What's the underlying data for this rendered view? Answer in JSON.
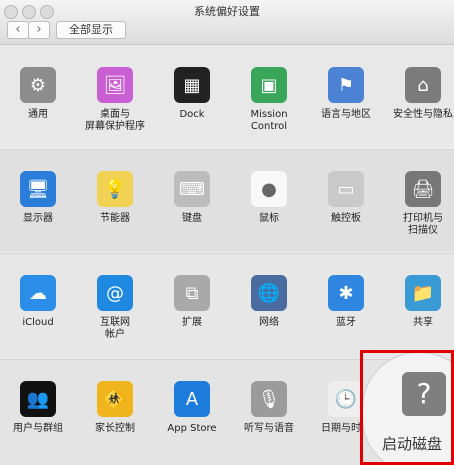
{
  "window": {
    "title": "系统偏好设置"
  },
  "toolbar": {
    "back": "‹",
    "forward": "›",
    "show_all": "全部显示"
  },
  "rows": [
    [
      {
        "name": "general",
        "label": "通用",
        "color": "#8d8d8d"
      },
      {
        "name": "desktop-screensaver",
        "label": "桌面与\n屏幕保护程序",
        "color": "#c95fd3"
      },
      {
        "name": "dock",
        "label": "Dock",
        "color": "#222222"
      },
      {
        "name": "mission-control",
        "label": "Mission\nControl",
        "color": "#3aa65a"
      },
      {
        "name": "language-region",
        "label": "语言与地区",
        "color": "#4b82d4"
      },
      {
        "name": "security-privacy",
        "label": "安全性与隐私",
        "color": "#7b7b7b"
      }
    ],
    [
      {
        "name": "displays",
        "label": "显示器",
        "color": "#2a7dd8"
      },
      {
        "name": "energy-saver",
        "label": "节能器",
        "color": "#f1d254"
      },
      {
        "name": "keyboard",
        "label": "键盘",
        "color": "#bcbcbc"
      },
      {
        "name": "mouse",
        "label": "鼠标",
        "color": "#f8f8f8"
      },
      {
        "name": "trackpad",
        "label": "触控板",
        "color": "#c9c9c9"
      },
      {
        "name": "printers-scanners",
        "label": "打印机与\n扫描仪",
        "color": "#777777"
      }
    ],
    [
      {
        "name": "icloud",
        "label": "iCloud",
        "color": "#2a8de8"
      },
      {
        "name": "internet-accounts",
        "label": "互联网\n帐户",
        "color": "#1f88e0"
      },
      {
        "name": "extensions",
        "label": "扩展",
        "color": "#a9a9a9"
      },
      {
        "name": "network",
        "label": "网络",
        "color": "#4b6ca0"
      },
      {
        "name": "bluetooth",
        "label": "蓝牙",
        "color": "#2f86e0"
      },
      {
        "name": "sharing",
        "label": "共享",
        "color": "#3a9ad6"
      }
    ],
    [
      {
        "name": "users-groups",
        "label": "用户与群组",
        "color": "#111111"
      },
      {
        "name": "parental-controls",
        "label": "家长控制",
        "color": "#f0b41c"
      },
      {
        "name": "app-store",
        "label": "App Store",
        "color": "#1e7cdd"
      },
      {
        "name": "dictation-speech",
        "label": "听写与语音",
        "color": "#9b9b9b"
      },
      {
        "name": "date-time",
        "label": "日期与时间",
        "color": "#eeeeee"
      },
      {
        "name": "startup-disk",
        "label": "启动磁盘",
        "color": "#808080"
      }
    ]
  ],
  "icon_glyphs": {
    "general": "⚙",
    "desktop-screensaver": "🖼",
    "dock": "▦",
    "mission-control": "▣",
    "language-region": "⚑",
    "security-privacy": "⌂",
    "displays": "🖥",
    "energy-saver": "💡",
    "keyboard": "⌨",
    "mouse": "●",
    "trackpad": "▭",
    "printers-scanners": "🖨",
    "icloud": "☁",
    "internet-accounts": "@",
    "extensions": "⧉",
    "network": "🌐",
    "bluetooth": "✱",
    "sharing": "📁",
    "users-groups": "👥",
    "parental-controls": "🚸",
    "app-store": "A",
    "dictation-speech": "🎙",
    "date-time": "🕒",
    "startup-disk": "?"
  }
}
